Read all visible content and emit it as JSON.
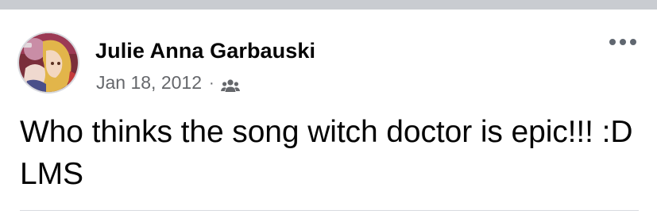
{
  "post": {
    "author": "Julie Anna Garbauski",
    "date": "Jan 18, 2012",
    "separator": "·",
    "audience_icon": "friends-icon",
    "more_icon": "more-options-icon",
    "text": "Who thinks the song witch doctor is epic!!! :D LMS"
  },
  "colors": {
    "top_band": "#c9ccd1",
    "author_text": "#050505",
    "meta_text": "#65676b",
    "divider": "#d8dadf"
  }
}
